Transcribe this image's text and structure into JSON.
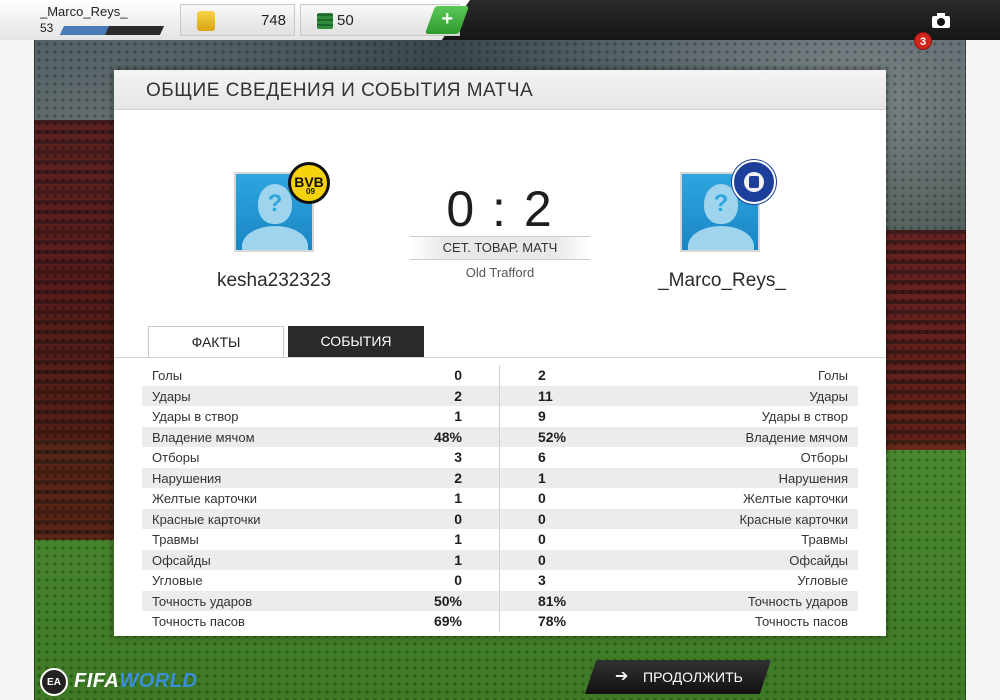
{
  "topbar": {
    "username": "_Marco_Reys_",
    "level": "53",
    "xp_progress": 0.45,
    "coins": "748",
    "points": "50",
    "add_label": "+",
    "notification_count": "3"
  },
  "panel": {
    "title": "ОБЩИЕ СВЕДЕНИЯ И СОБЫТИЯ МАТЧА"
  },
  "match": {
    "home_team": "kesha232323",
    "away_team": "_Marco_Reys_",
    "score": "0 : 2",
    "type": "СЕТ. ТОВАР. МАТЧ",
    "venue": "Old Trafford",
    "home_badge_text": "BVB",
    "home_badge_sub": "09",
    "home_badge_club": "Borussia Dortmund",
    "away_badge_club": "Chelsea"
  },
  "tabs": [
    {
      "label": "ФАКТЫ",
      "active": true
    },
    {
      "label": "СОБЫТИЯ",
      "active": false
    }
  ],
  "stats": [
    {
      "label": "Голы",
      "home": "0",
      "away": "2"
    },
    {
      "label": "Удары",
      "home": "2",
      "away": "11"
    },
    {
      "label": "Удары в створ",
      "home": "1",
      "away": "9"
    },
    {
      "label": "Владение мячом",
      "home": "48%",
      "away": "52%"
    },
    {
      "label": "Отборы",
      "home": "3",
      "away": "6"
    },
    {
      "label": "Нарушения",
      "home": "2",
      "away": "1"
    },
    {
      "label": "Желтые карточки",
      "home": "1",
      "away": "0"
    },
    {
      "label": "Красные карточки",
      "home": "0",
      "away": "0"
    },
    {
      "label": "Травмы",
      "home": "1",
      "away": "0"
    },
    {
      "label": "Офсайды",
      "home": "1",
      "away": "0"
    },
    {
      "label": "Угловые",
      "home": "0",
      "away": "3"
    },
    {
      "label": "Точность ударов",
      "home": "50%",
      "away": "81%"
    },
    {
      "label": "Точность пасов",
      "home": "69%",
      "away": "78%"
    }
  ],
  "footer": {
    "logo_ea": "EA",
    "logo_fifa": "FIFA",
    "logo_world": "WORLD",
    "continue_label": "ПРОДОЛЖИТЬ",
    "continue_icon": "arrow-right-icon"
  },
  "colors": {
    "accent_green": "#2d9a2e",
    "avatar_blue": "#2ea6e0",
    "dark_button": "#1e1e1e",
    "badge_red": "#d0261e"
  }
}
